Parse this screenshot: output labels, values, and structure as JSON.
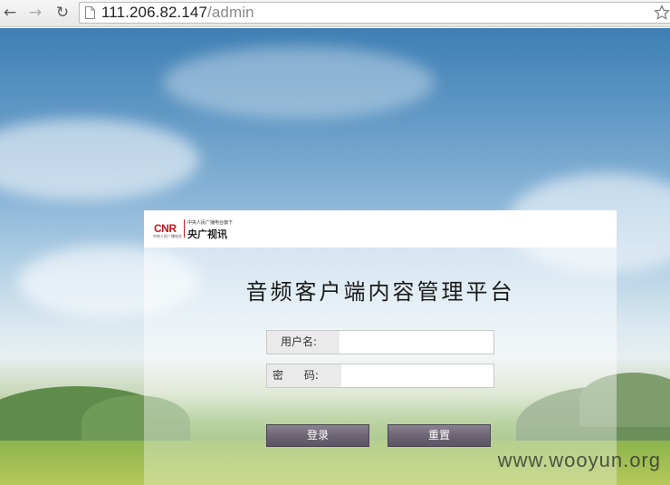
{
  "browser": {
    "url_host": "111.206.82.147",
    "url_path": "/admin"
  },
  "logo": {
    "mark": "CNR",
    "subtitle_small": "中央人民广播电台",
    "tagline_small": "中央人民广播电台旗下",
    "brand_name": "央广视讯"
  },
  "login": {
    "title": "音频客户端内容管理平台",
    "username_label": "用户名:",
    "username_value": "",
    "password_label": "密      码:",
    "password_value": "",
    "login_button": "登录",
    "reset_button": "重置"
  },
  "watermark": "www.wooyun.org",
  "colors": {
    "cnr_red": "#c8161d",
    "button_bg": "#6d6574",
    "panel_header": "#ffffff"
  },
  "icons": [
    "back-arrow-icon",
    "forward-arrow-icon",
    "reload-icon",
    "page-icon",
    "bookmark-star-icon"
  ]
}
